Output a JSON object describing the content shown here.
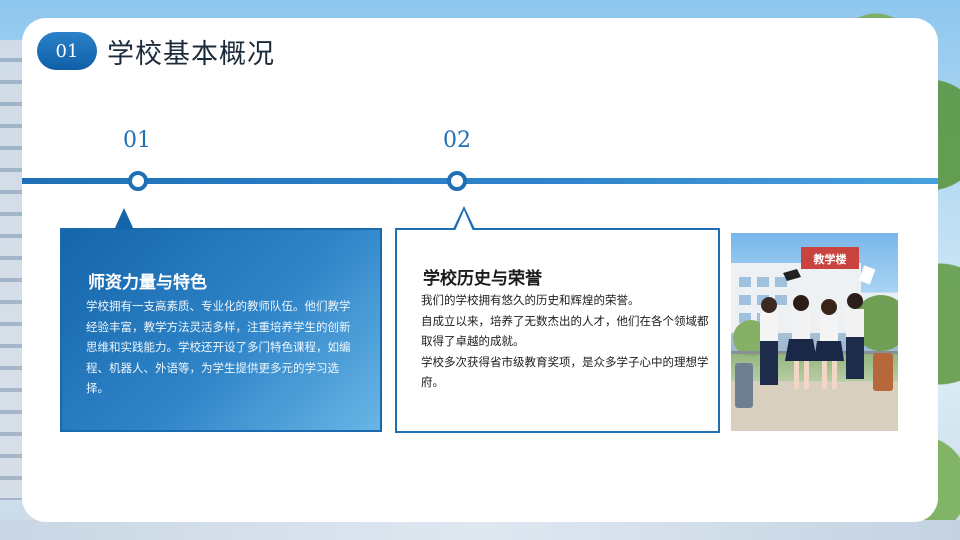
{
  "header": {
    "badge": "01",
    "title": "学校基本概况"
  },
  "timeline": {
    "steps": [
      {
        "number": "01"
      },
      {
        "number": "02"
      }
    ]
  },
  "cards": [
    {
      "title": "师资力量与特色",
      "text": "学校拥有一支高素质、专业化的教师队伍。他们教学经验丰富，教学方法灵活多样，注重培养学生的创新思维和实践能力。学校还开设了多门特色课程，如编程、机器人、外语等，为学生提供更多元的学习选择。"
    },
    {
      "title": "学校历史与荣誉",
      "paragraphs": [
        "我们的学校拥有悠久的历史和辉煌的荣誉。",
        "自成立以来，培养了无数杰出的人才，他们在各个领域都取得了卓越的成就。",
        "学校多次获得省市级教育奖项，是众多学子心中的理想学府。"
      ]
    }
  ],
  "photo": {
    "sign_text": "教学楼"
  },
  "colors": {
    "accent": "#1f6fb4",
    "accent_dark": "#1565aa",
    "accent_light": "#69b6e6"
  }
}
